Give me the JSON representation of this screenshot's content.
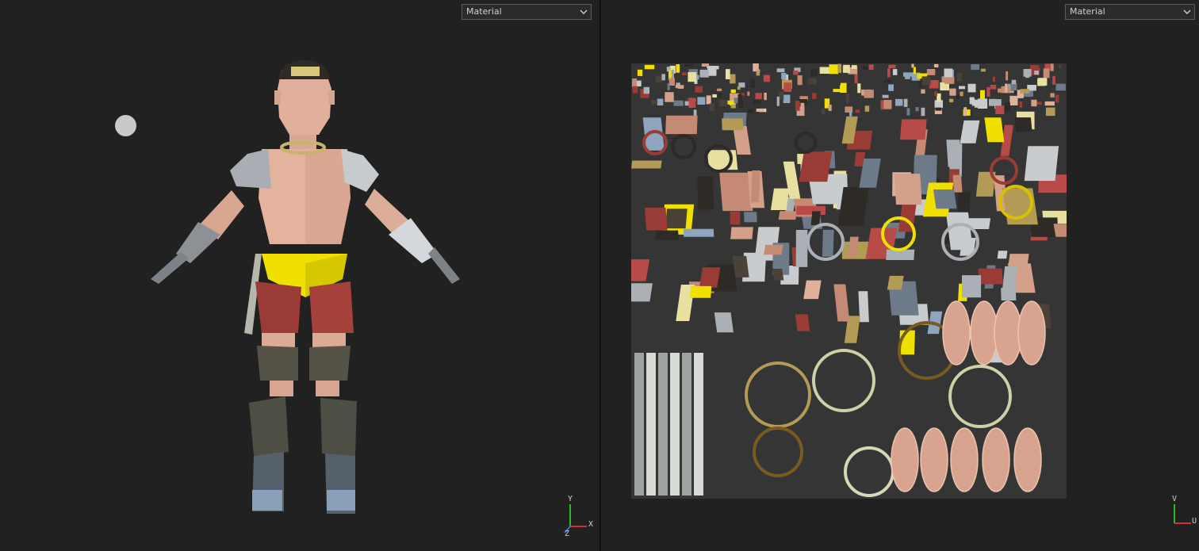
{
  "left_viewport": {
    "shading_mode": "Material",
    "axis_labels": {
      "y": "Y",
      "x": "X",
      "z": "Z"
    }
  },
  "right_viewport": {
    "shading_mode": "Material",
    "axis_labels": {
      "v": "V",
      "u": "U"
    }
  },
  "colors": {
    "viewport_bg": "#222121",
    "skin": "#e0b09a",
    "shorts": "#9b3b36",
    "belt": "#f0e000",
    "armor": "#aab0b6",
    "hair": "#2e2a26"
  }
}
